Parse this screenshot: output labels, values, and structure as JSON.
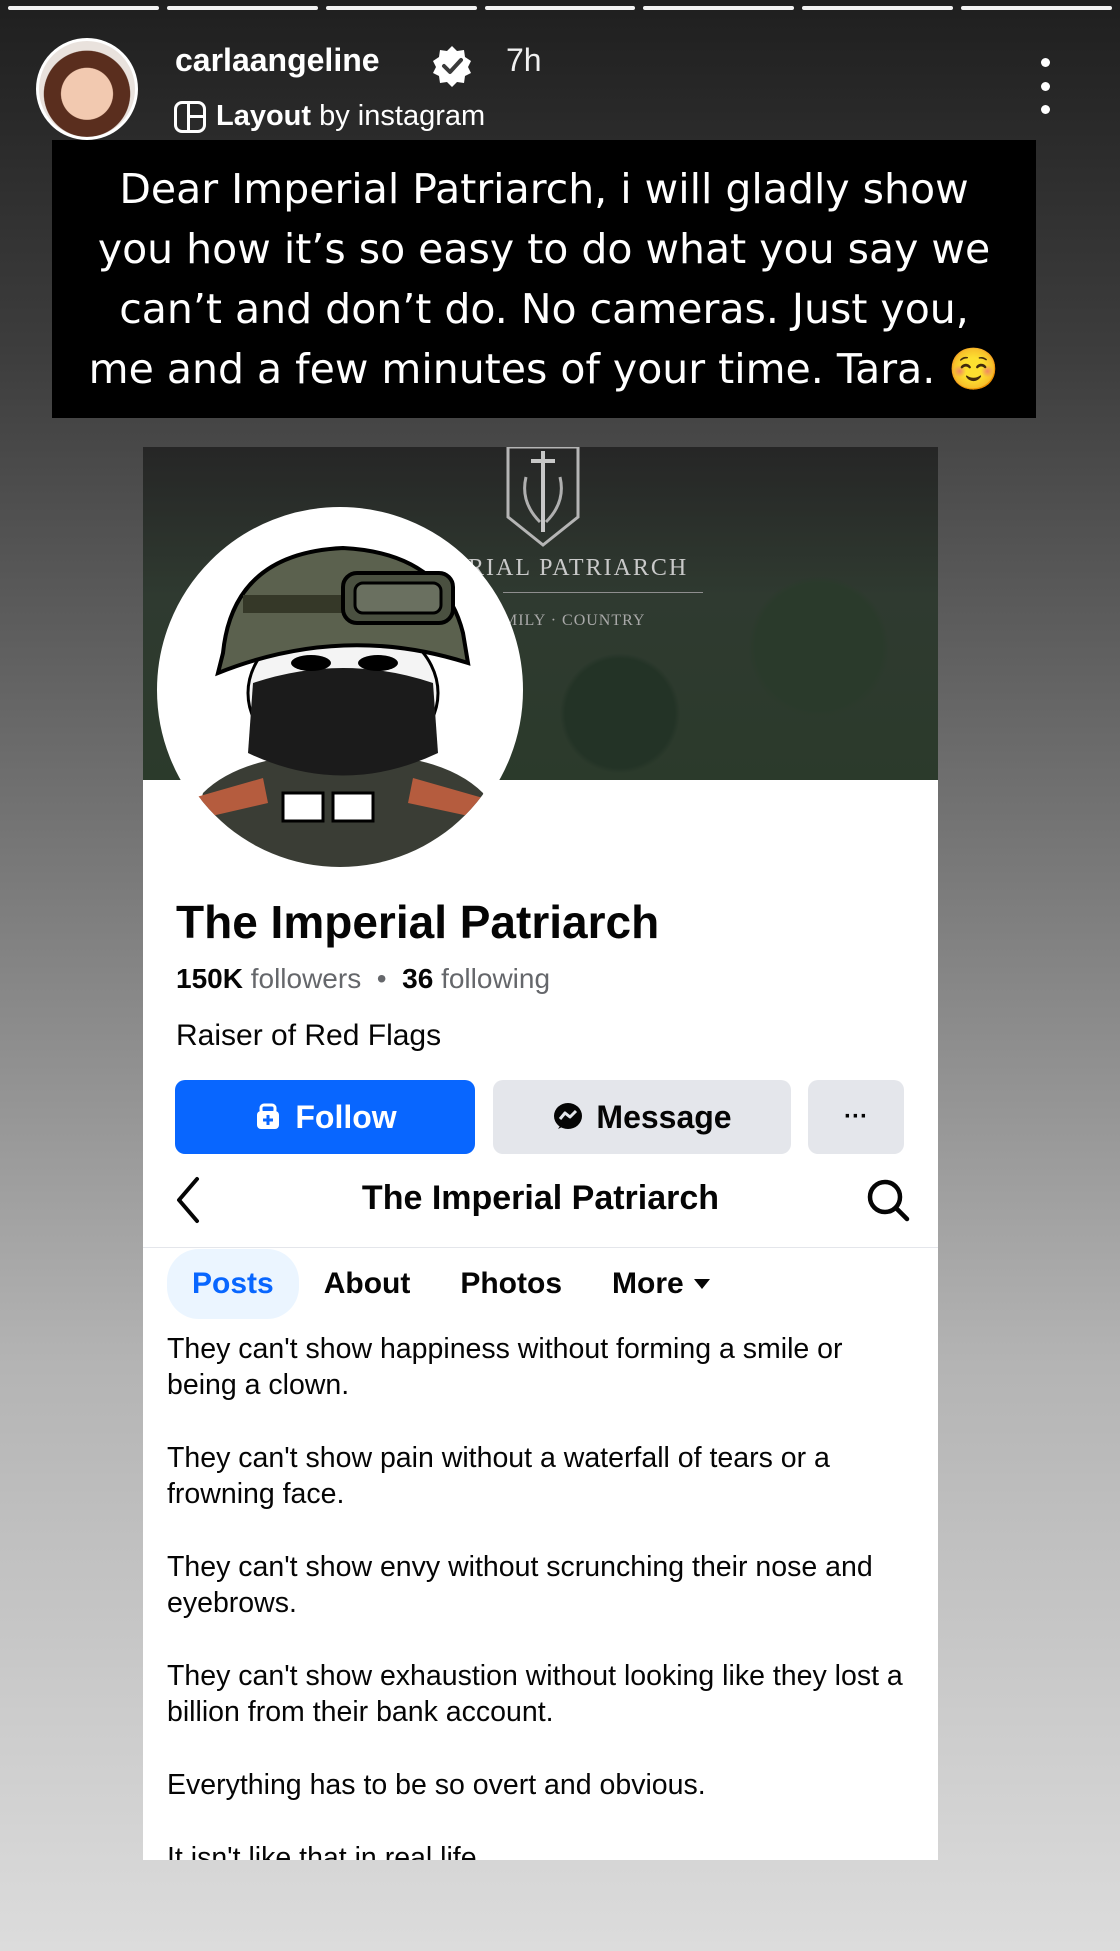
{
  "story": {
    "progress_segments": 7,
    "username": "carlaangeline",
    "time_ago": "7h",
    "layout_bold": "Layout",
    "layout_rest": "by instagram",
    "caption": "Dear Imperial Patriarch, i will gladly show you how it’s so easy to do what you say we can’t and don’t do. No cameras. Just you, me and a few minutes of your time. Tara. ☺️"
  },
  "embedded_page": {
    "cover_title": "RIAL PATRIARCH",
    "cover_subtitle": "MILY · COUNTRY",
    "page_name": "The Imperial Patriarch",
    "followers_count": "150K",
    "followers_label": "followers",
    "separator": "•",
    "following_count": "36",
    "following_label": "following",
    "bio": "Raiser of Red Flags",
    "follow_label": "Follow",
    "message_label": "Message",
    "more_label": "···",
    "nav_title": "The Imperial Patriarch",
    "tabs": [
      {
        "label": "Posts",
        "active": true
      },
      {
        "label": "About",
        "active": false
      },
      {
        "label": "Photos",
        "active": false
      },
      {
        "label": "More",
        "active": false
      }
    ],
    "post_paragraphs": [
      "They can't show happiness without forming a smile or being a clown.",
      "They can't show pain without a waterfall of tears or a frowning face.",
      "They can't show envy without scrunching their nose and eyebrows.",
      "They can't show exhaustion without looking like they lost a billion from their bank account.",
      "Everything has to be so overt and obvious.",
      "It isn't like that in real life."
    ]
  },
  "colors": {
    "facebook_blue": "#0866ff",
    "tab_active_bg": "#ebf5ff",
    "verified_badge": "#ffffff"
  },
  "icons": [
    "verified-badge-icon",
    "layout-icon",
    "more-options-icon",
    "crest-icon",
    "follow-icon",
    "messenger-icon",
    "back-arrow-icon",
    "search-icon",
    "caret-down-icon"
  ]
}
